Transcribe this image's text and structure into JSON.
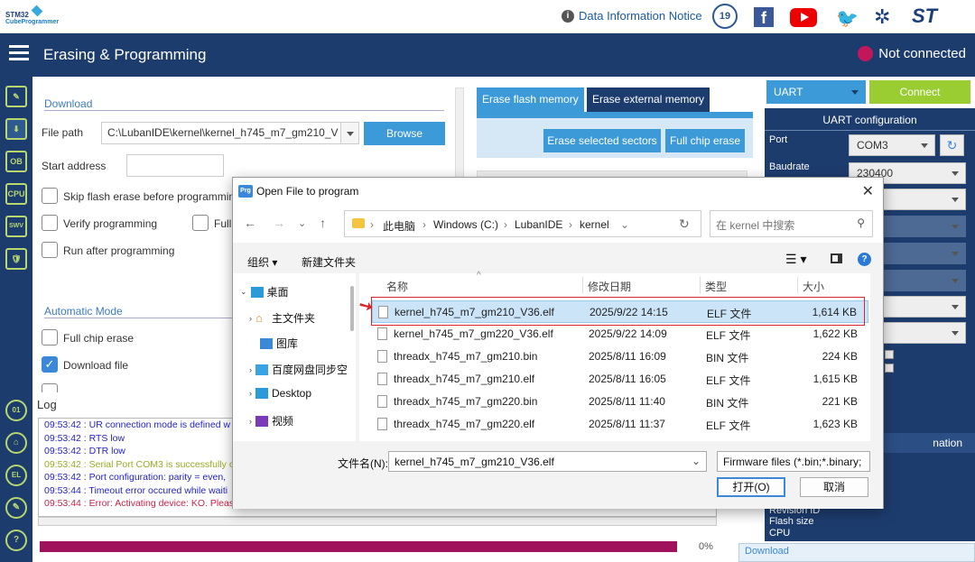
{
  "topbar": {
    "logo_line1": "STM32",
    "logo_line2": "CubeProgrammer",
    "notice": "Data Information Notice",
    "badge": "19",
    "facebook": "f",
    "twitter": "🐦",
    "network": "✲",
    "st_logo": "ST"
  },
  "header": {
    "title": "Erasing & Programming",
    "status": "Not connected"
  },
  "sidebar": {
    "items": [
      "✎",
      "⬇",
      "OB",
      "CPU",
      "SWV",
      "🛡"
    ],
    "round_items": [
      "01",
      "⌂",
      "EL",
      "✎",
      "?"
    ]
  },
  "download": {
    "section": "Download",
    "file_path_label": "File path",
    "file_path_value": "C:\\LubanIDE\\kernel\\kernel_h745_m7_gm210_V",
    "browse": "Browse",
    "start_address_label": "Start address",
    "skip_erase": "Skip flash erase before programming",
    "verify": "Verify programming",
    "full_cut": "Full",
    "run_after": "Run after programming"
  },
  "auto": {
    "section": "Automatic Mode",
    "full_chip": "Full chip erase",
    "download_file": "Download file"
  },
  "erase": {
    "tab1": "Erase flash memory",
    "tab2": "Erase external memory",
    "btn1": "Erase selected sectors",
    "btn2": "Full chip erase"
  },
  "log": {
    "title": "Log",
    "lines": [
      {
        "text": "09:53:42 : UR connection mode is defined w",
        "color": "#2222cc"
      },
      {
        "text": "09:53:42 : RTS low",
        "color": "#2222cc"
      },
      {
        "text": "09:53:42 : DTR low",
        "color": "#2222cc"
      },
      {
        "text": "09:53:42 : Serial Port COM3 is successfully o",
        "color": "#9aaa22"
      },
      {
        "text": "09:53:42 : Port configuration: parity = even,",
        "color": "#2222cc"
      },
      {
        "text": "09:53:44 : Timeout error occured while waiti",
        "color": "#2222cc"
      },
      {
        "text": "09:53:44 : Error: Activating device: KO. Pleas",
        "color": "#cc2244"
      }
    ],
    "progress_pct": "0%",
    "progress_value": 0
  },
  "right": {
    "interface": "UART",
    "connect": "Connect",
    "config_title": "UART configuration",
    "port_label": "Port",
    "port_value": "COM3",
    "baud_label": "Baudrate",
    "baud_value": "230400",
    "info_title": "nation",
    "flash_size": "Flash size",
    "cpu": "CPU",
    "revision": "Revision ID",
    "bottom_tab": "Download"
  },
  "dialog": {
    "title": "Open File to program",
    "icon": "Prg",
    "breadcrumbs": [
      "此电脑",
      "Windows (C:)",
      "LubanIDE",
      "kernel"
    ],
    "search_placeholder": "在 kernel 中搜索",
    "organize": "组织 ▾",
    "new_folder": "新建文件夹",
    "tree": [
      "桌面",
      "主文件夹",
      "图库",
      "百度网盘同步空",
      "Desktop",
      "视频"
    ],
    "columns": [
      "名称",
      "修改日期",
      "类型",
      "大小"
    ],
    "files": [
      {
        "name": "kernel_h745_m7_gm210_V36.elf",
        "date": "2025/9/22 14:15",
        "type": "ELF 文件",
        "size": "1,614 KB"
      },
      {
        "name": "kernel_h745_m7_gm220_V36.elf",
        "date": "2025/9/22 14:09",
        "type": "ELF 文件",
        "size": "1,622 KB"
      },
      {
        "name": "threadx_h745_m7_gm210.bin",
        "date": "2025/8/11 16:09",
        "type": "BIN 文件",
        "size": "224 KB"
      },
      {
        "name": "threadx_h745_m7_gm210.elf",
        "date": "2025/8/11 16:05",
        "type": "ELF 文件",
        "size": "1,615 KB"
      },
      {
        "name": "threadx_h745_m7_gm220.bin",
        "date": "2025/8/11 11:40",
        "type": "BIN 文件",
        "size": "221 KB"
      },
      {
        "name": "threadx_h745_m7_gm220.elf",
        "date": "2025/8/11 11:37",
        "type": "ELF 文件",
        "size": "1,623 KB"
      }
    ],
    "filename_label": "文件名(N):",
    "filename_value": "kernel_h745_m7_gm210_V36.elf",
    "filter": "Firmware files (*.bin;*.binary;",
    "open": "打开(O)",
    "cancel": "取消"
  },
  "colors": {
    "navy": "#1d3c6e",
    "accent_green": "#9acd32",
    "blue_btn": "#3c9ad8",
    "progress": "#a0135c",
    "red_highlight": "#d8262b"
  }
}
